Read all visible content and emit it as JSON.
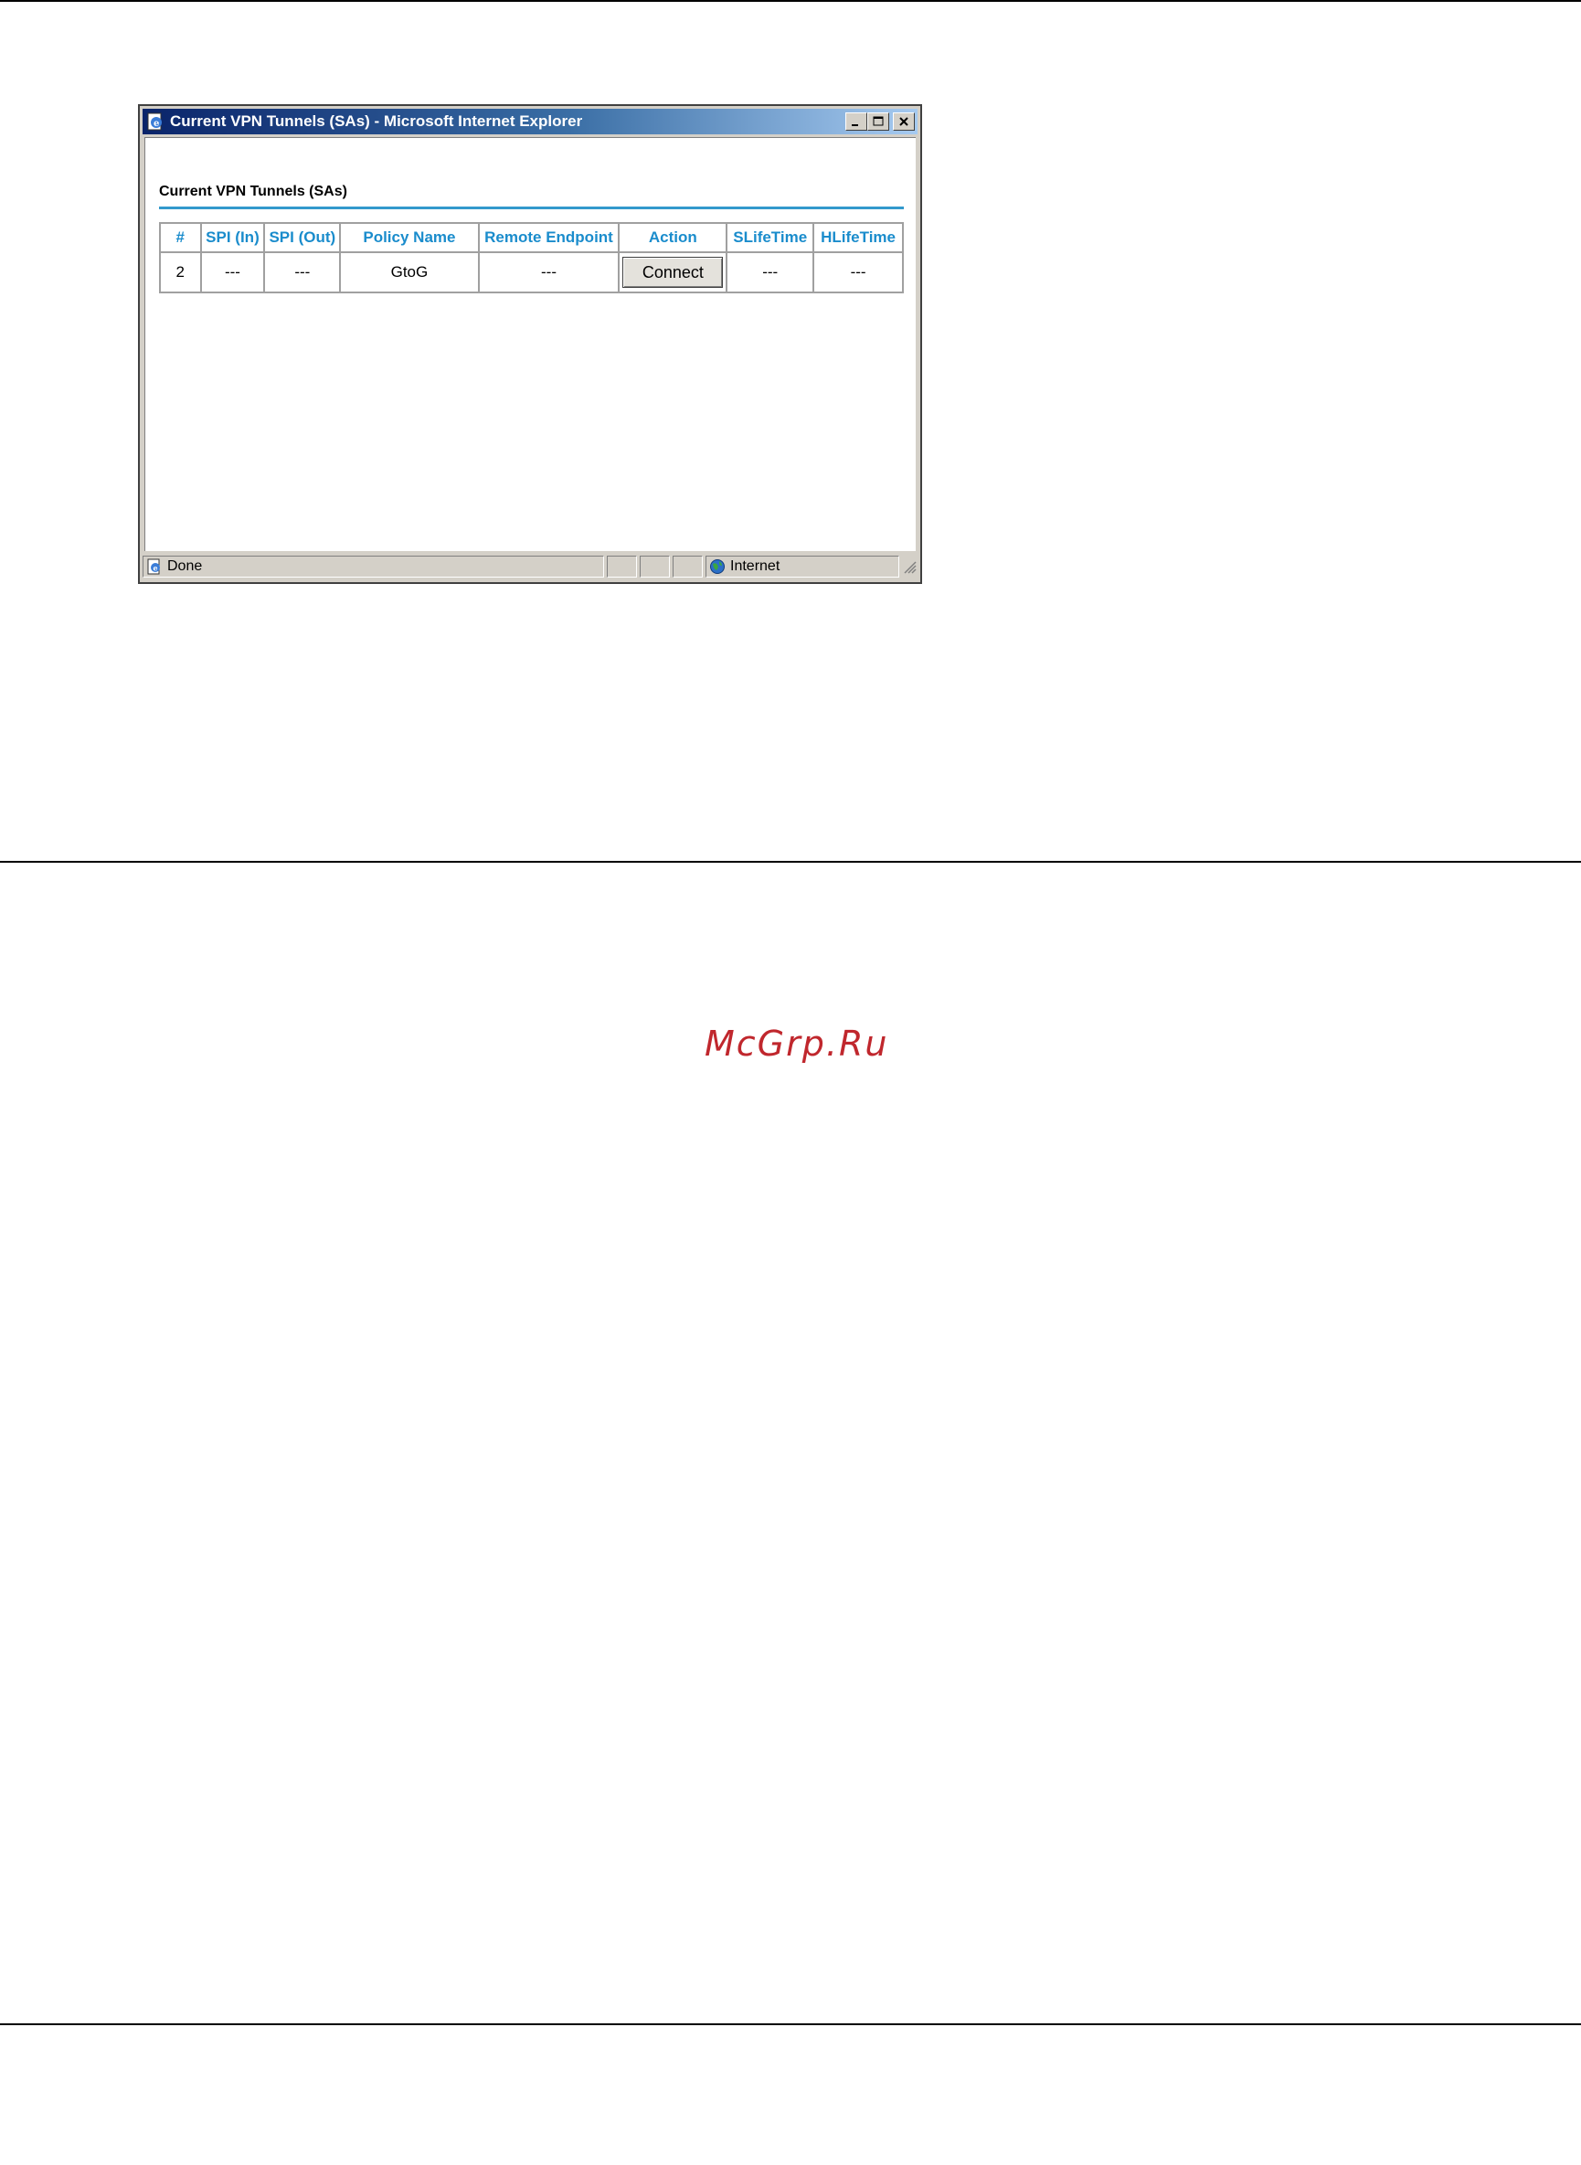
{
  "window": {
    "title": "Current VPN Tunnels (SAs) - Microsoft Internet Explorer"
  },
  "page": {
    "heading": "Current VPN Tunnels (SAs)"
  },
  "table": {
    "headers": [
      "#",
      "SPI (In)",
      "SPI (Out)",
      "Policy Name",
      "Remote Endpoint",
      "Action",
      "SLifeTime",
      "HLifeTime"
    ],
    "rows": [
      {
        "num": "2",
        "spi_in": "---",
        "spi_out": "---",
        "policy_name": "GtoG",
        "remote_endpoint": "---",
        "action_label": "Connect",
        "slifetime": "---",
        "hlifetime": "---"
      }
    ]
  },
  "statusbar": {
    "status": "Done",
    "zone": "Internet"
  },
  "watermark": "McGrp.Ru",
  "icons": {
    "app": "ie-page-icon",
    "status": "ie-page-icon",
    "zone": "globe-icon"
  },
  "colors": {
    "titlebar_start": "#0a246a",
    "header_text": "#1a8ccc",
    "heading_rule": "#3399cc",
    "watermark": "#c0272d"
  }
}
